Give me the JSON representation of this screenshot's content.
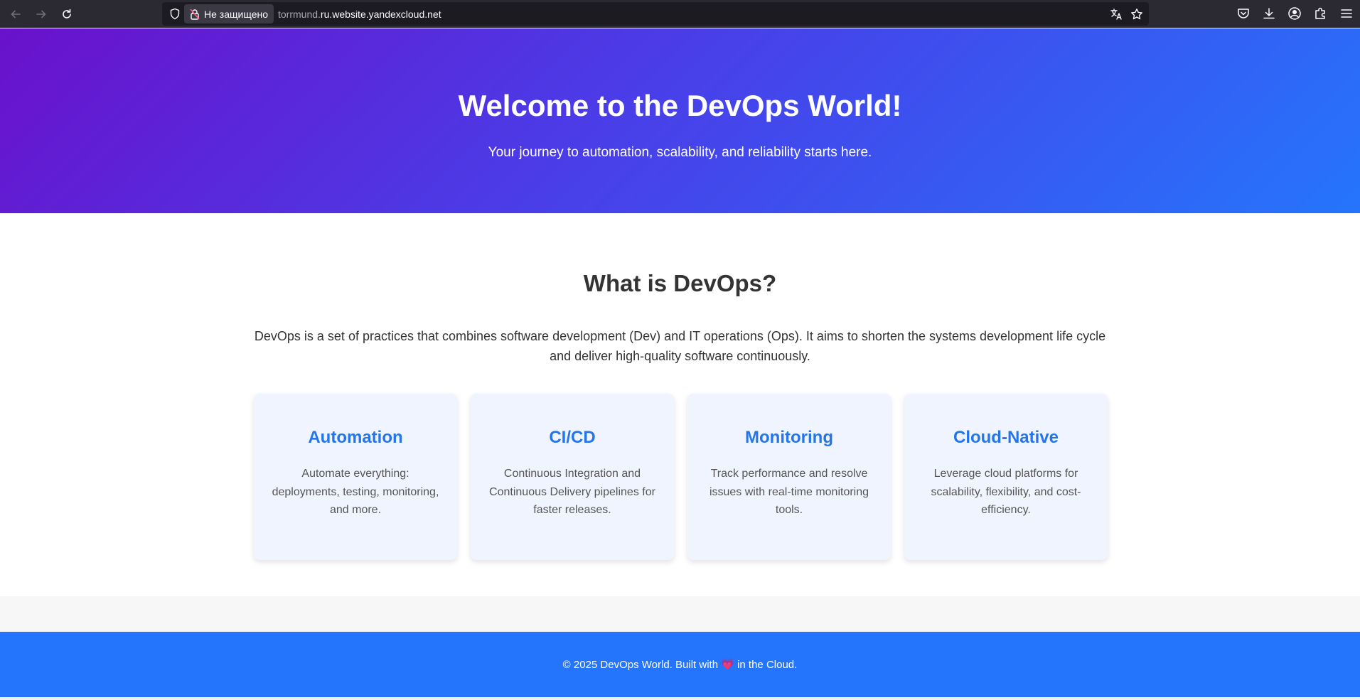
{
  "browser": {
    "security_label": "Не защищено",
    "url_subdomain": "torrmund.",
    "url_domain": "ru.website.yandexcloud.net",
    "icons": [
      "back-icon",
      "forward-icon",
      "reload-icon",
      "shield-icon",
      "lock-slash-icon",
      "translate-icon",
      "bookmark-star-icon",
      "pocket-icon",
      "download-icon",
      "account-icon",
      "extensions-icon",
      "menu-icon"
    ]
  },
  "hero": {
    "title": "Welcome to the DevOps World!",
    "subtitle": "Your journey to automation, scalability, and reliability starts here.",
    "gradient_start": "#6a11cb",
    "gradient_end": "#2575fc"
  },
  "intro": {
    "title": "What is DevOps?",
    "text": "DevOps is a set of practices that combines software development (Dev) and IT operations (Ops). It aims to shorten the systems development life cycle and deliver high-quality software continuously."
  },
  "cards": [
    {
      "title": "Automation",
      "text": "Automate everything: deployments, testing, monitoring, and more."
    },
    {
      "title": "CI/CD",
      "text": "Continuous Integration and Continuous Delivery pipelines for faster releases."
    },
    {
      "title": "Monitoring",
      "text": "Track performance and resolve issues with real-time monitoring tools."
    },
    {
      "title": "Cloud-Native",
      "text": "Leverage cloud platforms for scalability, flexibility, and cost-efficiency."
    }
  ],
  "footer": {
    "prefix": "© 2025 DevOps World. Built with",
    "heart": "💗",
    "suffix": "in the Cloud.",
    "color": "#2575fc"
  }
}
